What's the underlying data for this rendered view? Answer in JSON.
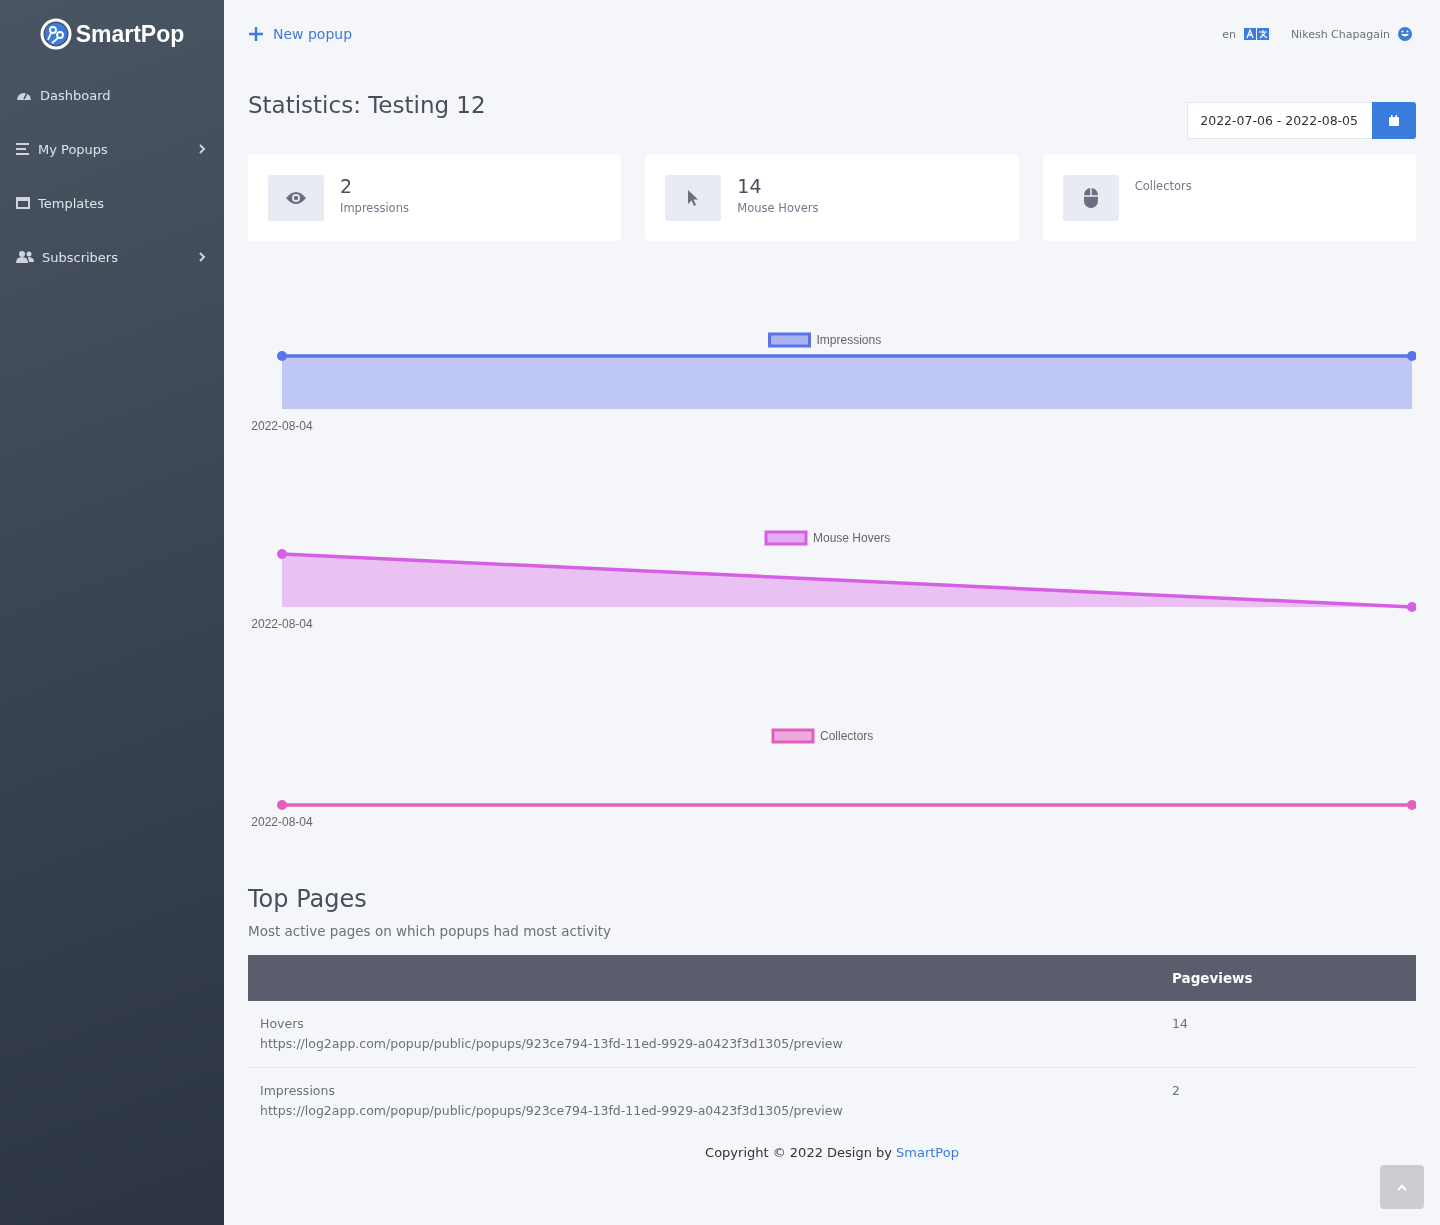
{
  "sidebar": {
    "logo": "SmartPop",
    "items": [
      {
        "label": "Dashboard",
        "kind": "gauge",
        "expandable": false
      },
      {
        "label": "My Popups",
        "kind": "list",
        "expandable": true
      },
      {
        "label": "Templates",
        "kind": "window",
        "expandable": false
      },
      {
        "label": "Subscribers",
        "kind": "users",
        "expandable": true
      }
    ]
  },
  "header": {
    "new_button": "New popup",
    "language": "en",
    "user": "Nikesh Chapagain"
  },
  "title": "Statistics: Testing 12",
  "date_range": "2022-07-06 - 2022-08-05",
  "stat_cards": [
    {
      "kind": "eye",
      "value": "2",
      "label": "Impressions"
    },
    {
      "kind": "pointer",
      "value": "14",
      "label": "Mouse Hovers"
    },
    {
      "kind": "mouse",
      "label": "Collectors"
    }
  ],
  "charts": [
    {
      "legend": "Impressions",
      "color": "#5b73e8",
      "kind": "flat-area",
      "x_label": "2022-08-04"
    },
    {
      "legend": "Mouse Hovers",
      "color": "#d65fe6",
      "kind": "falling-area",
      "x_label": "2022-08-04"
    },
    {
      "legend": "Collectors",
      "color": "#e35fbe",
      "kind": "flat-line",
      "x_label": "2022-08-04"
    }
  ],
  "top_pages": {
    "title": "Top Pages",
    "subtitle": "Most active pages on which popups had most activity",
    "columns": [
      "",
      "Pageviews"
    ],
    "rows": [
      {
        "name": "Hovers",
        "url": "https://log2app.com/popup/public/popups/923ce794-13fd-11ed-9929-a0423f3d1305/preview",
        "pageviews": "14"
      },
      {
        "name": "Impressions",
        "url": "https://log2app.com/popup/public/popups/923ce794-13fd-11ed-9929-a0423f3d1305/preview",
        "pageviews": "2"
      }
    ]
  },
  "footer": {
    "text": "Copyright © 2022 Design by",
    "link": "SmartPop"
  }
}
